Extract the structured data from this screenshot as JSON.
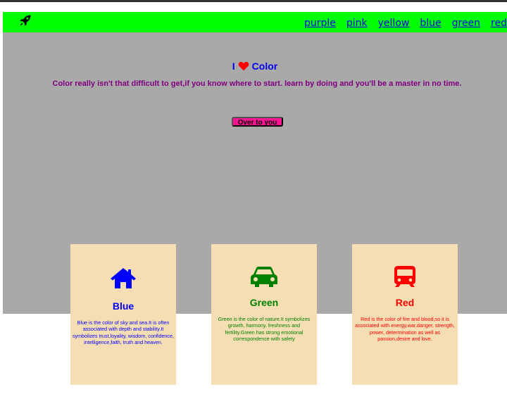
{
  "nav": {
    "logo_icon": "rocket-icon",
    "links": [
      "purple",
      "pink",
      "yellow",
      "blue",
      "green",
      "red"
    ]
  },
  "hero": {
    "title_prefix": "I",
    "heart_icon": "heart-icon",
    "title_suffix": "Color",
    "description": "Color really isn't that difficult to get,if you know where to start. learn by doing and you'll be a master in no time.",
    "cta_label": "Over to you"
  },
  "cards": [
    {
      "icon": "home-icon",
      "title": "Blue",
      "text": "Blue is the color of sky and sea.It is often associated with depth and stability.It symbolizes trust,loyality, wisdom, confidence, intelligence,faith, truth and heaven.",
      "color": "#0000ff"
    },
    {
      "icon": "car-icon",
      "title": "Green",
      "text": "Green is the color of nature.It symbolizes growth, harmony, freshness and fertility.Green has strong emotional correspondence with safety",
      "color": "#008000"
    },
    {
      "icon": "train-icon",
      "title": "Red",
      "text": "Red is the color of fire and blood,so it is associated with energy,war,danger, strength, power, determination as well as passion,desire and love.",
      "color": "#ff0000"
    }
  ],
  "colors": {
    "nav_bg": "#00ff00",
    "hero_bg": "#a9a9a9",
    "card_bg": "#f5deb3",
    "cta_bg": "#ff1493"
  }
}
